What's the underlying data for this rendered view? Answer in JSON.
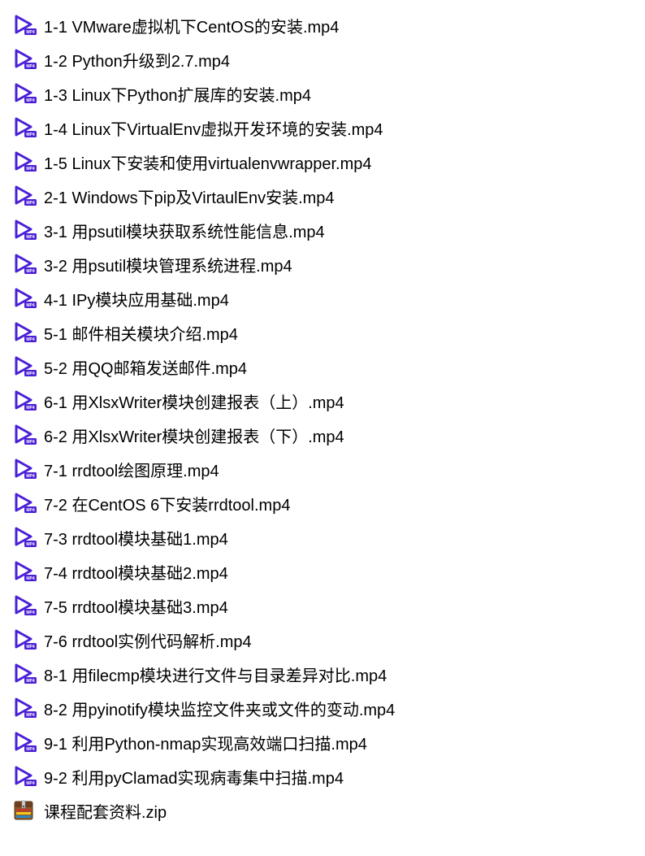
{
  "files": [
    {
      "name": "1-1 VMware虚拟机下CentOS的安装.mp4",
      "type": "mp4"
    },
    {
      "name": "1-2 Python升级到2.7.mp4",
      "type": "mp4"
    },
    {
      "name": "1-3 Linux下Python扩展库的安装.mp4",
      "type": "mp4"
    },
    {
      "name": "1-4 Linux下VirtualEnv虚拟开发环境的安装.mp4",
      "type": "mp4"
    },
    {
      "name": "1-5 Linux下安装和使用virtualenvwrapper.mp4",
      "type": "mp4"
    },
    {
      "name": "2-1 Windows下pip及VirtaulEnv安装.mp4",
      "type": "mp4"
    },
    {
      "name": "3-1 用psutil模块获取系统性能信息.mp4",
      "type": "mp4"
    },
    {
      "name": "3-2 用psutil模块管理系统进程.mp4",
      "type": "mp4"
    },
    {
      "name": "4-1 IPy模块应用基础.mp4",
      "type": "mp4"
    },
    {
      "name": "5-1 邮件相关模块介绍.mp4",
      "type": "mp4"
    },
    {
      "name": "5-2 用QQ邮箱发送邮件.mp4",
      "type": "mp4"
    },
    {
      "name": "6-1 用XlsxWriter模块创建报表（上）.mp4",
      "type": "mp4"
    },
    {
      "name": "6-2 用XlsxWriter模块创建报表（下）.mp4",
      "type": "mp4"
    },
    {
      "name": "7-1 rrdtool绘图原理.mp4",
      "type": "mp4"
    },
    {
      "name": "7-2 在CentOS 6下安装rrdtool.mp4",
      "type": "mp4"
    },
    {
      "name": "7-3 rrdtool模块基础1.mp4",
      "type": "mp4"
    },
    {
      "name": "7-4 rrdtool模块基础2.mp4",
      "type": "mp4"
    },
    {
      "name": "7-5 rrdtool模块基础3.mp4",
      "type": "mp4"
    },
    {
      "name": "7-6 rrdtool实例代码解析.mp4",
      "type": "mp4"
    },
    {
      "name": "8-1 用filecmp模块进行文件与目录差异对比.mp4",
      "type": "mp4"
    },
    {
      "name": "8-2 用pyinotify模块监控文件夹或文件的变动.mp4",
      "type": "mp4"
    },
    {
      "name": "9-1 利用Python-nmap实现高效端口扫描.mp4",
      "type": "mp4"
    },
    {
      "name": "9-2 利用pyClamad实现病毒集中扫描.mp4",
      "type": "mp4"
    },
    {
      "name": "课程配套资料.zip",
      "type": "zip"
    }
  ],
  "icons": {
    "mp4_badge_text": "MP4"
  },
  "colors": {
    "play_purple": "#4b1fd6",
    "zip_brown": "#8b5a2b",
    "zip_yellow": "#f5c518",
    "zip_red": "#c0392b"
  }
}
